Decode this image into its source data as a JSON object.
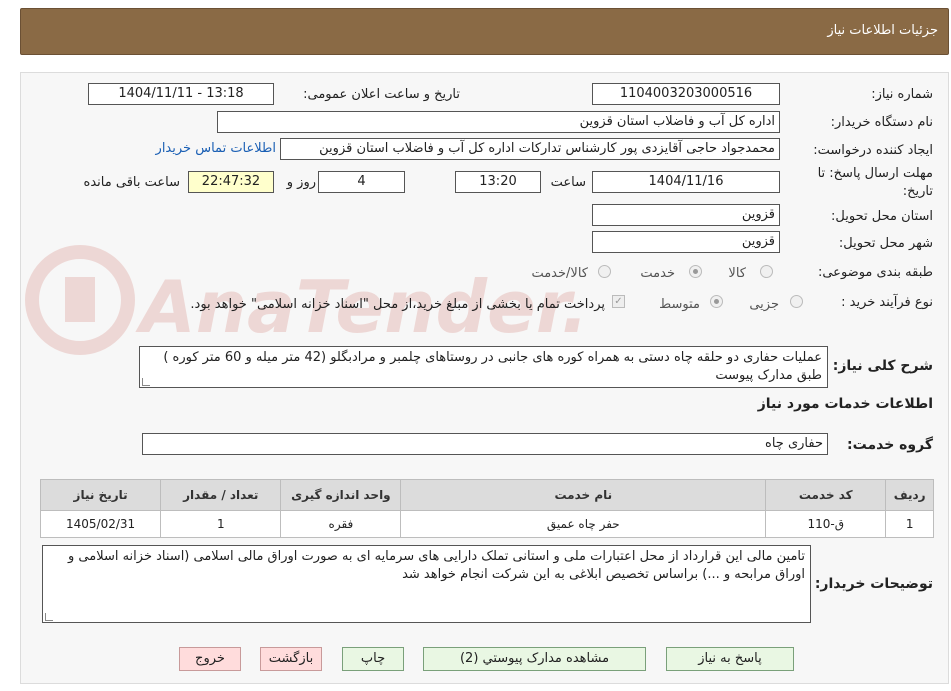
{
  "header": {
    "title": "جزئیات اطلاعات نیاز"
  },
  "form": {
    "need_number_label": "شماره نیاز:",
    "need_number": "1104003203000516",
    "announce_label": "تاریخ و ساعت اعلان عمومی:",
    "announce_value": "1404/11/11 - 13:18",
    "buyer_org_label": "نام دستگاه خریدار:",
    "buyer_org": "اداره کل آب و فاضلاب استان قزوین",
    "creator_label": "ایجاد کننده درخواست:",
    "creator": "محمدجواد حاجی آقایزدی پور کارشناس تدارکات اداره کل آب و فاضلاب استان قزوین",
    "contact_link": "اطلاعات تماس خریدار",
    "deadline_label_1": "مهلت ارسال پاسخ: تا",
    "deadline_label_2": "تاریخ:",
    "deadline_date": "1404/11/16",
    "hour_label": "ساعت",
    "deadline_time": "13:20",
    "days_value": "4",
    "days_label": "روز و",
    "remaining_time": "22:47:32",
    "remaining_label": "ساعت باقی مانده",
    "province_label": "استان محل تحویل:",
    "province": "قزوین",
    "city_label": "شهر محل تحویل:",
    "city": "قزوین",
    "category_label": "طبقه بندی موضوعی:",
    "category_options": [
      "کالا",
      "خدمت",
      "کالا/خدمت"
    ],
    "category_selected": "خدمت",
    "process_label": "نوع فرآیند خرید :",
    "process_options": [
      "جزیی",
      "متوسط"
    ],
    "process_selected": "متوسط",
    "payment_note": "پرداخت تمام یا بخشی از مبلغ خرید،از محل \"اسناد خزانه اسلامی\" خواهد بود.",
    "summary_label": "شرح کلی نیاز:",
    "summary": "عملیات حفاری دو حلقه چاه دستی به  همراه کوره های جانبی در روستاهای چلمبر و مرادبگلو (42 متر میله و 60 متر کوره ) طبق مدارک پیوست"
  },
  "services": {
    "section_title": "اطلاعات خدمات مورد نیاز",
    "group_label": "گروه خدمت:",
    "group_value": "حفاری چاه",
    "table": {
      "headers": [
        "ردیف",
        "کد خدمت",
        "نام خدمت",
        "واحد اندازه گیری",
        "تعداد / مقدار",
        "تاریخ نیاز"
      ],
      "rows": [
        [
          "1",
          "ق-110",
          "حفر چاه عمیق",
          "فقره",
          "1",
          "1405/02/31"
        ]
      ]
    }
  },
  "buyer_notes": {
    "label": "توضیحات خریدار:",
    "text": "تامین مالی این قرارداد از محل اعتبارات ملی و استانی تملک دارایی های سرمایه ای به صورت اوراق مالی اسلامی (اسناد خزانه اسلامی و اوراق مرابحه و ...) براساس تخصیص ابلاغی به این شرکت انجام خواهد شد"
  },
  "buttons": {
    "respond": "پاسخ به نیاز",
    "view_docs": "مشاهده مدارک پیوستي (2)",
    "print": "چاپ",
    "back": "بازگشت",
    "exit": "خروج"
  },
  "watermark": {
    "text": "AnaTender.net"
  },
  "colors": {
    "header_bg": "#8a6a45",
    "button_green": "#e9f7e3",
    "button_pink": "#ffdcdc",
    "link_blue": "#1a5fb4",
    "countdown_bg": "#ffffcc"
  }
}
